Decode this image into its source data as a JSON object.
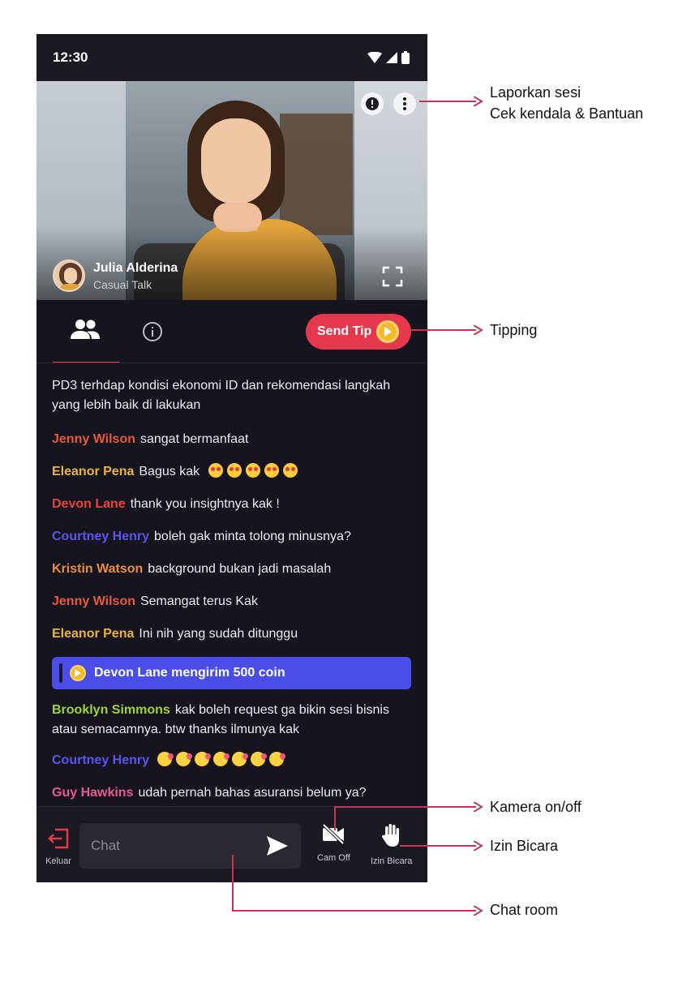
{
  "status_bar": {
    "time": "12:30"
  },
  "video": {
    "host_name": "Julia Alderina",
    "session_type": "Casual Talk"
  },
  "tabs": {
    "send_tip_label": "Send Tip"
  },
  "chat": {
    "intro_text": "PD3 terhdap kondisi ekonomi ID dan rekomendasi langkah yang lebih baik di lakukan",
    "messages": [
      {
        "user": "Jenny Wilson",
        "text": "sangat bermanfaat",
        "color": "#e8593a"
      },
      {
        "user": "Eleanor Pena",
        "text": "Bagus kak",
        "color": "#e8b43a",
        "emoji_count": 5
      },
      {
        "user": "Devon Lane",
        "text": "thank you insightnya kak !",
        "color": "#e8413a"
      },
      {
        "user": "Courtney Henry",
        "text": "boleh gak minta tolong minusnya?",
        "color": "#5b54f0"
      },
      {
        "user": "Kristin Watson",
        "text": "background bukan jadi masalah",
        "color": "#e88e3a"
      },
      {
        "user": "Jenny Wilson",
        "text": "Semangat terus Kak",
        "color": "#e8593a"
      },
      {
        "user": "Eleanor Pena",
        "text": "Ini nih yang sudah ditunggu",
        "color": "#e8b43a"
      }
    ],
    "coin_notice": "Devon Lane mengirim 500 coin",
    "messages_after": [
      {
        "user": "Brooklyn Simmons",
        "text": "kak boleh request ga bikin sesi bisnis atau semacamnya. btw thanks ilmunya kak",
        "color": "#9ed43a"
      },
      {
        "user": "Courtney Henry",
        "text": "",
        "color": "#5b54f0",
        "emoji_count": 7
      },
      {
        "user": "Guy Hawkins",
        "text": "udah pernah bahas asuransi belum ya?",
        "color": "#e85a8e"
      }
    ]
  },
  "bottom_bar": {
    "exit_label": "Keluar",
    "chat_placeholder": "Chat",
    "cam_label": "Cam Off",
    "raise_hand_label": "Izin Bicara"
  },
  "annotations": {
    "report_line1": "Laporkan sesi",
    "report_line2": "Cek kendala & Bantuan",
    "tipping": "Tipping",
    "camera": "Kamera on/off",
    "raise_hand": "Izin Bicara",
    "chat_room": "Chat room"
  },
  "colors": {
    "accent_red": "#e6384d",
    "annotation_arrow": "#c53550",
    "banner_blue": "#4a4de8"
  }
}
